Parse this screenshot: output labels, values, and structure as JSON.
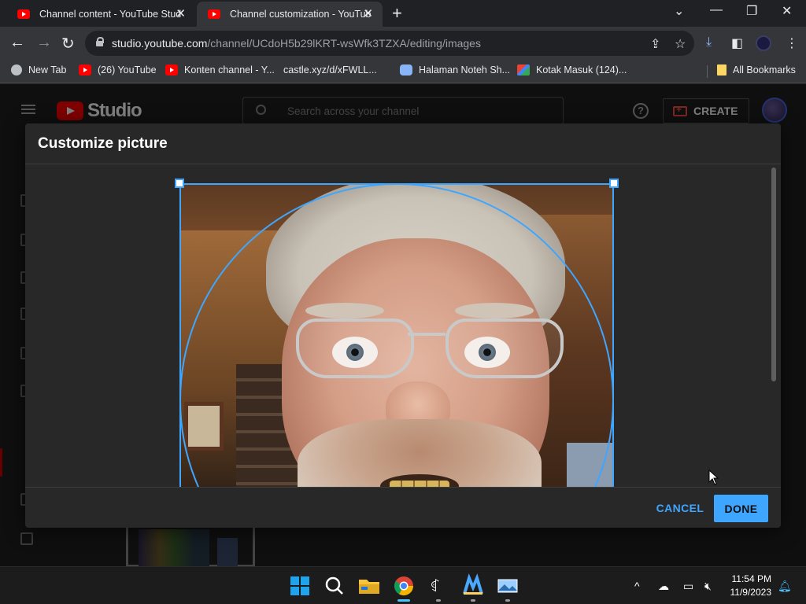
{
  "browser": {
    "tabs": [
      {
        "title": "Channel content - YouTube Stud",
        "active": false
      },
      {
        "title": "Channel customization - YouTub",
        "active": true
      }
    ],
    "url_domain": "studio.youtube.com",
    "url_path": "/channel/UCdoH5b29lKRT-wsWfk3TZXA/editing/images",
    "bookmarks": [
      {
        "label": "New Tab",
        "icon": "globe-icon"
      },
      {
        "label": "(26) YouTube",
        "icon": "youtube-icon"
      },
      {
        "label": "Konten channel - Y...",
        "icon": "youtube-icon"
      },
      {
        "label": "castle.xyz/d/xFWLL...",
        "icon": "page-icon"
      },
      {
        "label": "Halaman Noteh Sh...",
        "icon": "bot-icon"
      },
      {
        "label": "Kotak Masuk (124)...",
        "icon": "gmail-icon"
      }
    ],
    "all_bookmarks": "All Bookmarks"
  },
  "studio": {
    "logo_text": "Studio",
    "search_placeholder": "Search across your channel",
    "create_label": "CREATE"
  },
  "modal": {
    "title": "Customize picture",
    "cancel_label": "CANCEL",
    "done_label": "DONE",
    "accent_color": "#3ea6ff"
  },
  "taskbar": {
    "time": "11:54 PM",
    "date": "11/9/2023"
  }
}
